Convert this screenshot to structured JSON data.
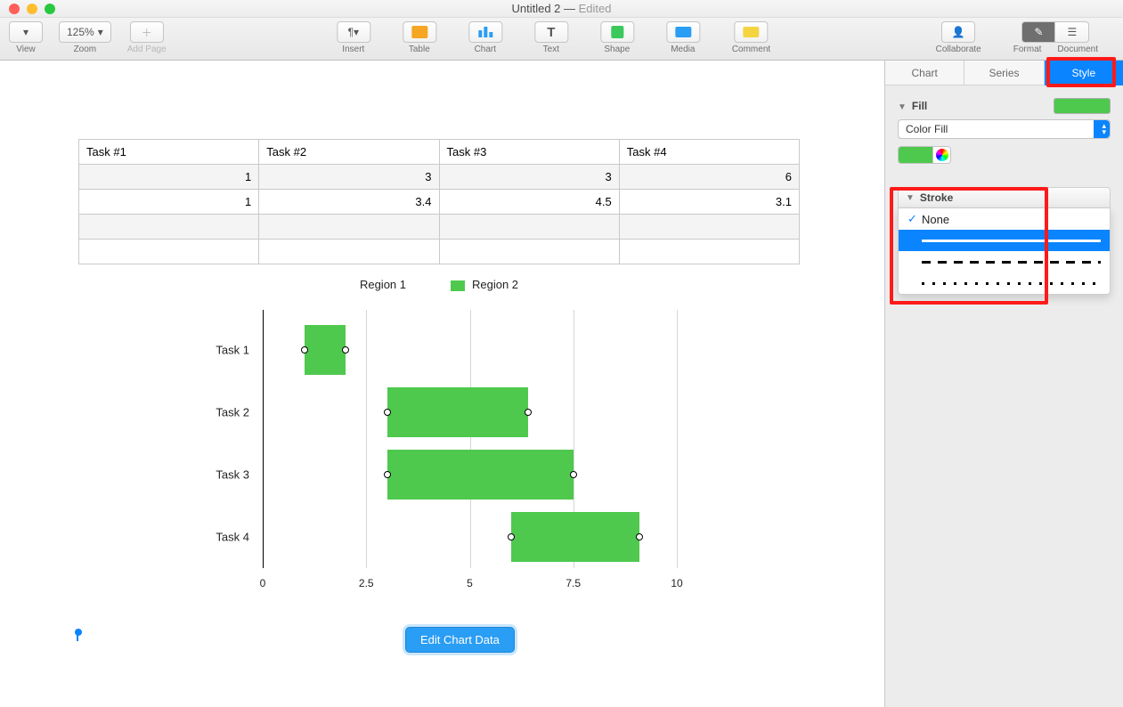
{
  "window": {
    "title": "Untitled 2",
    "edited": "Edited"
  },
  "toolbar": {
    "view": "View",
    "zoom": "Zoom",
    "zoom_value": "125%",
    "add_page": "Add Page",
    "insert": "Insert",
    "table": "Table",
    "chart": "Chart",
    "text": "Text",
    "shape": "Shape",
    "media": "Media",
    "comment": "Comment",
    "collaborate": "Collaborate",
    "format": "Format",
    "document": "Document"
  },
  "table": {
    "headers": [
      "Task #1",
      "Task #2",
      "Task #3",
      "Task #4"
    ],
    "rows": [
      [
        "1",
        "3",
        "3",
        "6"
      ],
      [
        "1",
        "3.4",
        "4.5",
        "3.1"
      ],
      [
        "",
        "",
        "",
        ""
      ],
      [
        "",
        "",
        "",
        ""
      ]
    ]
  },
  "legend": {
    "r1": "Region 1",
    "r2": "Region 2"
  },
  "chart_data": {
    "type": "bar",
    "orientation": "horizontal",
    "categories": [
      "Task 1",
      "Task 2",
      "Task 3",
      "Task 4"
    ],
    "series": [
      {
        "name": "Region 1",
        "start": [
          1,
          3,
          3,
          6
        ],
        "span": [
          1,
          3.4,
          4.5,
          3.1
        ],
        "color": "#4ec94e"
      }
    ],
    "xlabel": "",
    "ylabel": "",
    "xticks": [
      0,
      2.5,
      5,
      7.5,
      10
    ],
    "xlim": [
      0,
      10
    ]
  },
  "edit_btn": "Edit Chart Data",
  "inspector": {
    "tabs": [
      "Chart",
      "Series",
      "Style"
    ],
    "fill": {
      "title": "Fill",
      "type": "Color Fill",
      "color": "#4ec94e"
    },
    "stroke": {
      "title": "Stroke",
      "options": [
        "None",
        "solid",
        "dashed",
        "dotted"
      ],
      "selected": "None"
    }
  }
}
